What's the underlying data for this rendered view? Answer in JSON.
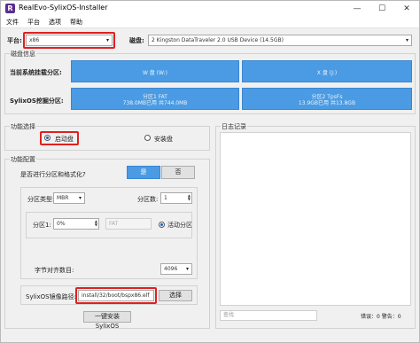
{
  "window": {
    "title": "RealEvo-SylixOS-Installer",
    "app_icon": "R",
    "minimize": "—",
    "maximize": "☐",
    "close": "✕"
  },
  "menu": [
    "文件",
    "平台",
    "选项",
    "帮助"
  ],
  "platform": {
    "label": "平台:",
    "value": "x86",
    "arrow": "▾"
  },
  "disk": {
    "label": "磁盘:",
    "value": "2 Kingston DataTraveler 2.0 USB Device (14.5GB)",
    "arrow": "▾"
  },
  "disk_info": {
    "title": "磁盘信息",
    "rows": [
      {
        "label": "当前系统挂载分区:",
        "cells": [
          {
            "text": "W 盘 (W:)"
          },
          {
            "text": "X 盘 (J:)"
          }
        ]
      },
      {
        "label": "SylixOS挖掘分区:",
        "cells": [
          {
            "line1": "分区1    FAT",
            "line2": "738.0MB已用    共744.0MB"
          },
          {
            "line1": "分区2    TpsFs",
            "line2": "13.9GB已用    共13.8GB"
          }
        ]
      }
    ]
  },
  "func_select": {
    "title": "功能选择",
    "boot": "启动盘",
    "install": "安装盘"
  },
  "func_config": {
    "title": "功能配置",
    "partition_question": "是否进行分区和格式化?",
    "yes": "是",
    "no": "否",
    "part_type_label": "分区类型:",
    "part_type_value": "MBR",
    "part_count_label": "分区数:",
    "part_count_value": "1",
    "partition_label": "分区1:",
    "partition_value": "0%",
    "fs_value": "FAT",
    "active_label": "活动分区",
    "align_label": "字节对齐数目:",
    "align_value": "4096",
    "image_label": "SylixOS镜像路径:",
    "image_path": "install/32/boot/bspx86.elf",
    "browse": "选择",
    "install_button": "一键安装SylixOS"
  },
  "log": {
    "title": "日志记录",
    "search_placeholder": "查找",
    "status": "错误：0 警告：0"
  }
}
